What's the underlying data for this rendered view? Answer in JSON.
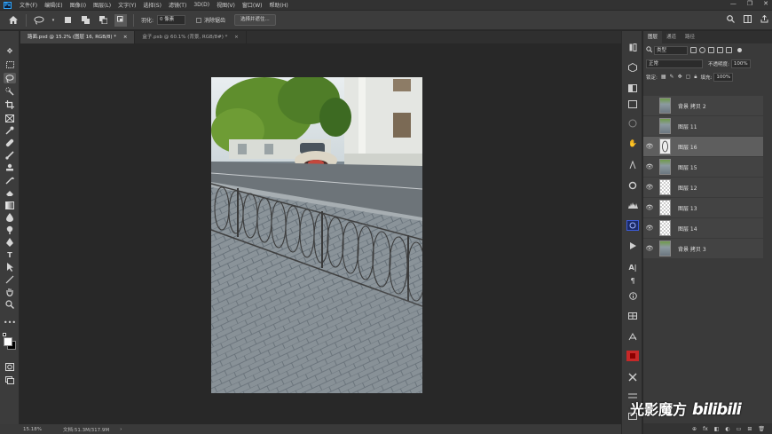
{
  "menubar": {
    "logo": "Ps",
    "items": [
      "文件(F)",
      "编辑(E)",
      "图像(I)",
      "图层(L)",
      "文字(Y)",
      "选择(S)",
      "滤镜(T)",
      "3D(D)",
      "视图(V)",
      "窗口(W)",
      "帮助(H)"
    ],
    "controls": [
      "—",
      "❐",
      "✕"
    ]
  },
  "options": {
    "feather_label": "羽化:",
    "feather_value": "0 像素",
    "antialias_label": "消除锯齿",
    "select_subject": "选择并遮住..."
  },
  "tabs": [
    {
      "label": "路面.psd @ 15.2% (图层 16, RGB/8) *",
      "close": "×",
      "active": true
    },
    {
      "label": "盒子.psb @ 60.1% (背景, RGB/8#) *",
      "close": "×",
      "active": false
    }
  ],
  "status": {
    "zoom": "15.18%",
    "doc_info": "文档:51.3M/317.9M",
    "arrow": "›"
  },
  "panel": {
    "tabs": [
      "图层",
      "通道",
      "路径"
    ],
    "filter_kind": "类型",
    "blend_mode": "正常",
    "opacity_label": "不透明度:",
    "opacity_value": "100%",
    "lock_label": "锁定:",
    "fill_label": "填充:",
    "fill_value": "100%",
    "layers": [
      {
        "name": "背景 拷贝 2",
        "visible": false,
        "thumb": "photo",
        "selected": false
      },
      {
        "name": "图层 11",
        "visible": false,
        "thumb": "photo",
        "selected": false
      },
      {
        "name": "图层 16",
        "visible": true,
        "thumb": "figure",
        "selected": true
      },
      {
        "name": "图层 15",
        "visible": true,
        "thumb": "photo",
        "selected": false
      },
      {
        "name": "图层 12",
        "visible": true,
        "thumb": "check",
        "selected": false
      },
      {
        "name": "图层 13",
        "visible": true,
        "thumb": "check",
        "selected": false
      },
      {
        "name": "图层 14",
        "visible": true,
        "thumb": "check",
        "selected": false
      },
      {
        "name": "背景 拷贝 3",
        "visible": true,
        "thumb": "photo",
        "selected": false
      }
    ],
    "bottom_icons": [
      "⊕",
      "fx",
      "◧",
      "◐",
      "▭",
      "⊞",
      "🗑"
    ]
  },
  "watermark": {
    "text1": "光影魔方",
    "text2": "bilibili"
  },
  "colors": {
    "accent": "#31a8ff",
    "panel_bg": "#3a3a3a",
    "canvas_bg": "#282828",
    "selected_layer": "#5e5e5e"
  }
}
